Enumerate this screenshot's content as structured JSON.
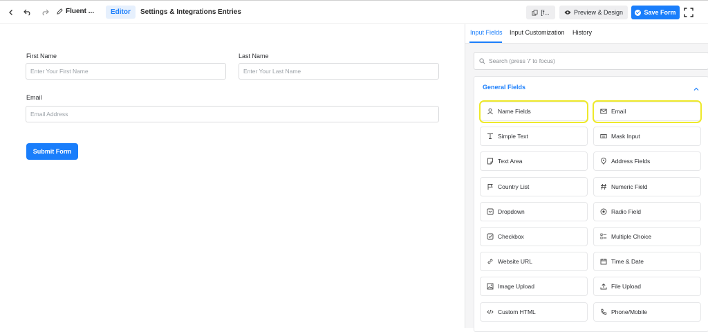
{
  "header": {
    "form_title": "Fluent ...",
    "tabs": [
      {
        "label": "Editor",
        "active": true
      },
      {
        "label": "Settings & Integrations",
        "active": false
      },
      {
        "label": "Entries",
        "active": false
      }
    ],
    "shortcode_label": "[f...",
    "preview_label": "Preview & Design",
    "save_label": "Save Form"
  },
  "form": {
    "first_name": {
      "label": "First Name",
      "placeholder": "Enter Your First Name"
    },
    "last_name": {
      "label": "Last Name",
      "placeholder": "Enter Your Last Name"
    },
    "email": {
      "label": "Email",
      "placeholder": "Email Address"
    },
    "submit_label": "Submit Form"
  },
  "panel": {
    "tabs": [
      {
        "label": "Input Fields",
        "active": true
      },
      {
        "label": "Input Customization",
        "active": false
      },
      {
        "label": "History",
        "active": false
      }
    ],
    "search_placeholder": "Search (press '/' to focus)",
    "group_title": "General Fields",
    "fields": [
      {
        "label": "Name Fields",
        "icon": "user-icon",
        "highlighted": true
      },
      {
        "label": "Email",
        "icon": "envelope-icon",
        "highlighted": true
      },
      {
        "label": "Simple Text",
        "icon": "text-icon",
        "highlighted": false
      },
      {
        "label": "Mask Input",
        "icon": "keyboard-icon",
        "highlighted": false
      },
      {
        "label": "Text Area",
        "icon": "textarea-icon",
        "highlighted": false
      },
      {
        "label": "Address Fields",
        "icon": "map-pin-icon",
        "highlighted": false
      },
      {
        "label": "Country List",
        "icon": "flag-icon",
        "highlighted": false
      },
      {
        "label": "Numeric Field",
        "icon": "hash-icon",
        "highlighted": false
      },
      {
        "label": "Dropdown",
        "icon": "dropdown-icon",
        "highlighted": false
      },
      {
        "label": "Radio Field",
        "icon": "radio-icon",
        "highlighted": false
      },
      {
        "label": "Checkbox",
        "icon": "checkbox-icon",
        "highlighted": false
      },
      {
        "label": "Multiple Choice",
        "icon": "list-icon",
        "highlighted": false
      },
      {
        "label": "Website URL",
        "icon": "link-icon",
        "highlighted": false
      },
      {
        "label": "Time & Date",
        "icon": "calendar-icon",
        "highlighted": false
      },
      {
        "label": "Image Upload",
        "icon": "image-icon",
        "highlighted": false
      },
      {
        "label": "File Upload",
        "icon": "upload-icon",
        "highlighted": false
      },
      {
        "label": "Custom HTML",
        "icon": "code-icon",
        "highlighted": false
      },
      {
        "label": "Phone/Mobile",
        "icon": "phone-icon",
        "highlighted": false
      }
    ]
  },
  "colors": {
    "accent": "#1a7efb",
    "highlight": "#eee92a"
  }
}
